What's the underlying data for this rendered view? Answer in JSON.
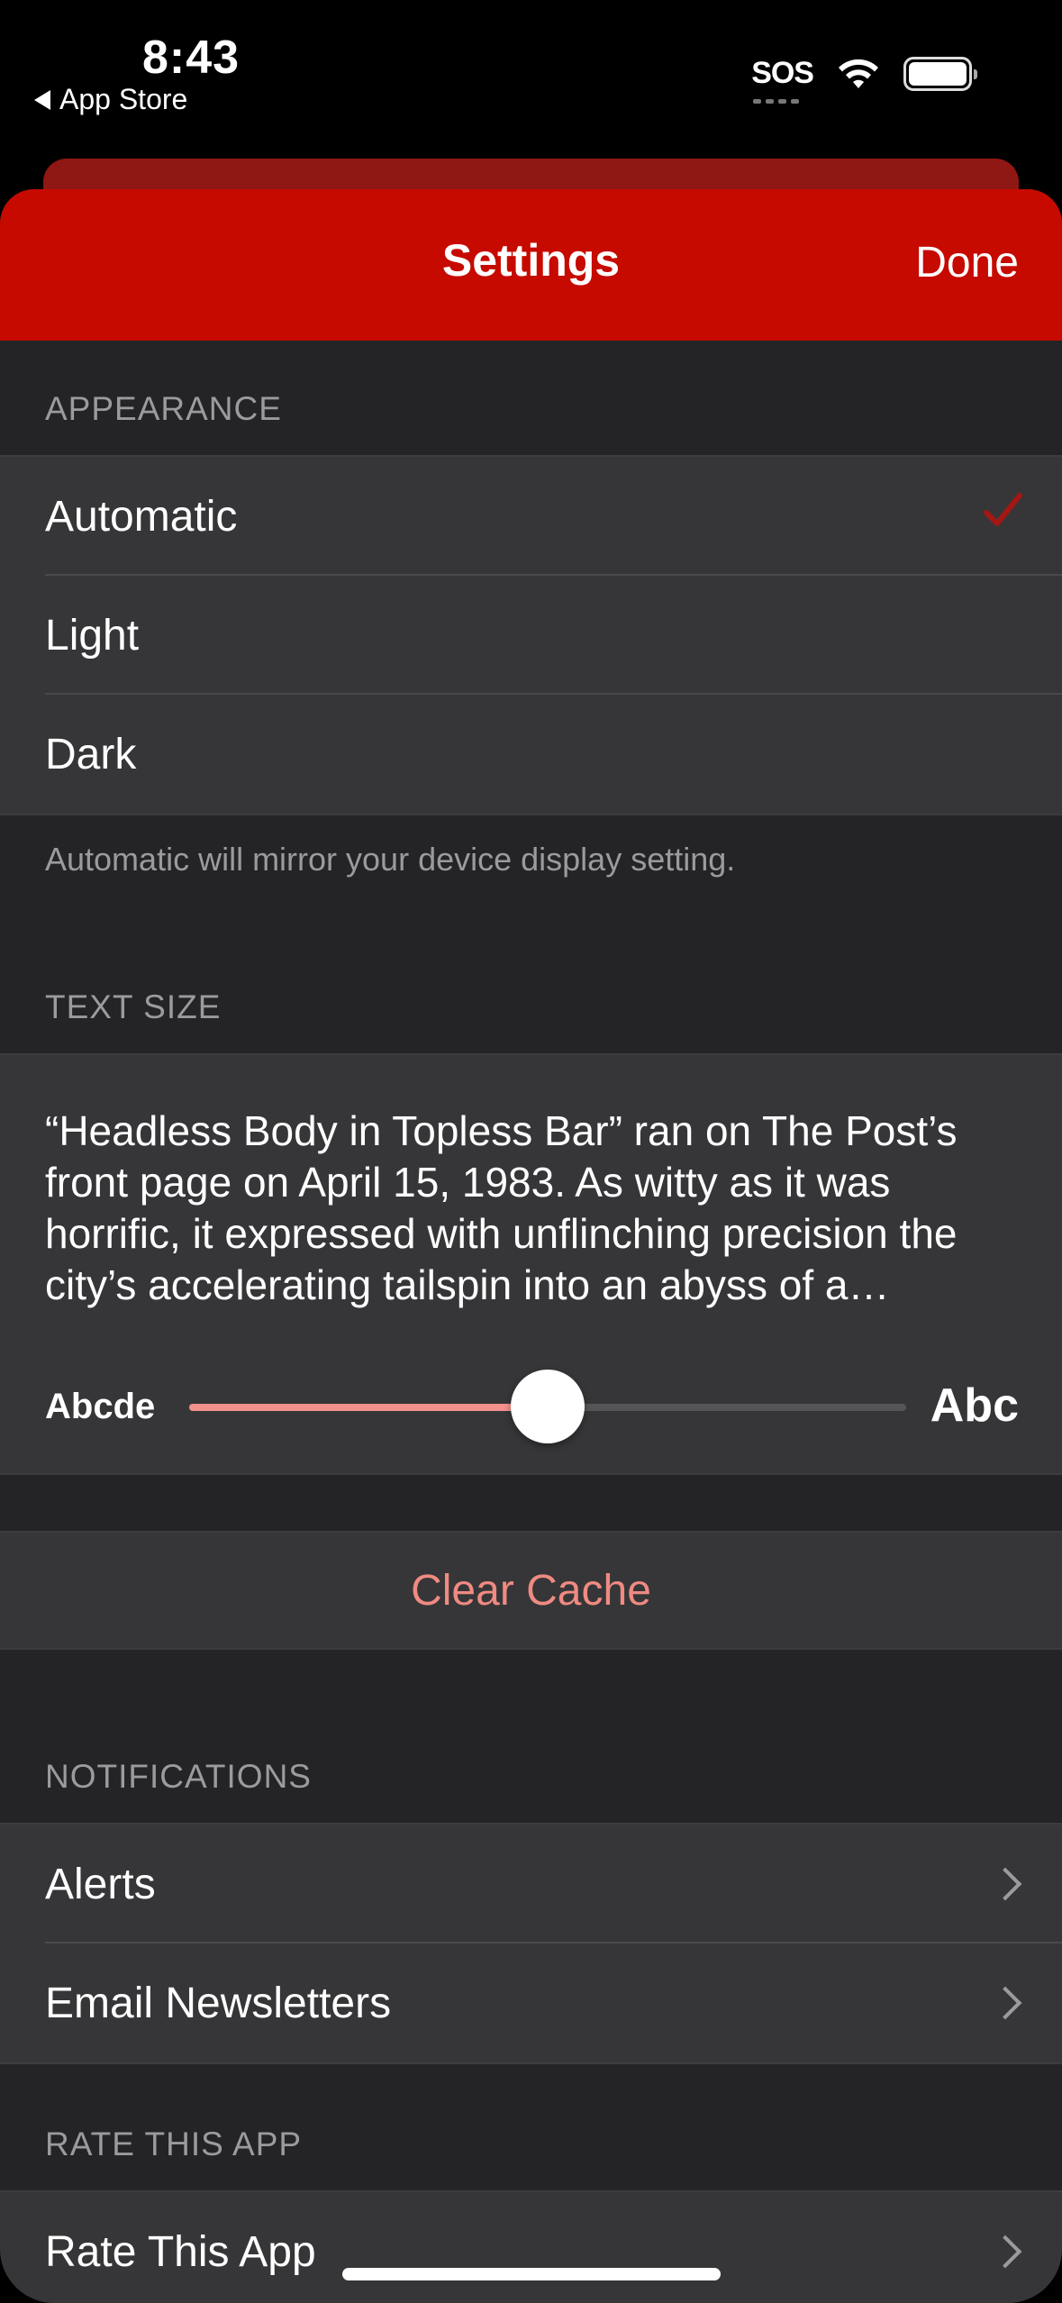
{
  "status_bar": {
    "time": "8:43",
    "back_label": "App Store",
    "sos": "SOS"
  },
  "nav": {
    "title": "Settings",
    "done_label": "Done",
    "color": "#c60a00"
  },
  "appearance": {
    "header": "APPEARANCE",
    "options": [
      {
        "label": "Automatic",
        "selected": true
      },
      {
        "label": "Light",
        "selected": false
      },
      {
        "label": "Dark",
        "selected": false
      }
    ],
    "footer": "Automatic will mirror your device display setting."
  },
  "text_size": {
    "header": "TEXT SIZE",
    "preview": "“Headless Body in Topless Bar” ran on The Post’s front page on April 15, 1983. As witty as it was horrific, it expressed with unflinching precision the city’s accelerating tailspin into an abyss of a…",
    "small_label": "Abcde",
    "large_label": "Abc",
    "slider_value": 0.5
  },
  "cache": {
    "clear_label": "Clear Cache"
  },
  "notifications": {
    "header": "NOTIFICATIONS",
    "items": [
      {
        "label": "Alerts"
      },
      {
        "label": "Email Newsletters"
      }
    ]
  },
  "rate": {
    "header": "RATE THIS APP",
    "item_label": "Rate This App"
  }
}
